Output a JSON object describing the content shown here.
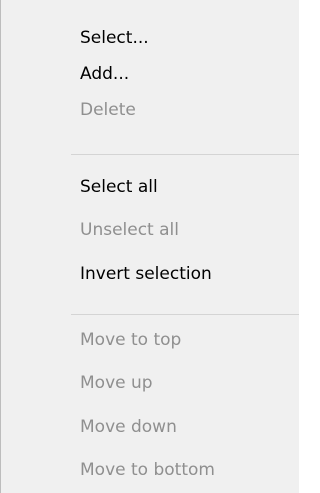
{
  "menu": {
    "items": [
      {
        "label": "Select...",
        "enabled": true
      },
      {
        "label": "Add...",
        "enabled": true
      },
      {
        "label": "Delete",
        "enabled": false
      },
      {
        "label": "Select all",
        "enabled": true
      },
      {
        "label": "Unselect all",
        "enabled": false
      },
      {
        "label": "Invert selection",
        "enabled": true
      },
      {
        "label": "Move to top",
        "enabled": false
      },
      {
        "label": "Move up",
        "enabled": false
      },
      {
        "label": "Move down",
        "enabled": false
      },
      {
        "label": "Move to bottom",
        "enabled": false
      }
    ]
  },
  "colors": {
    "menu_background": "#f0f0f0",
    "enabled_text": "#000000",
    "disabled_text": "#8f8f8f",
    "separator": "#d4d4d4",
    "border": "#bdbdbd"
  }
}
